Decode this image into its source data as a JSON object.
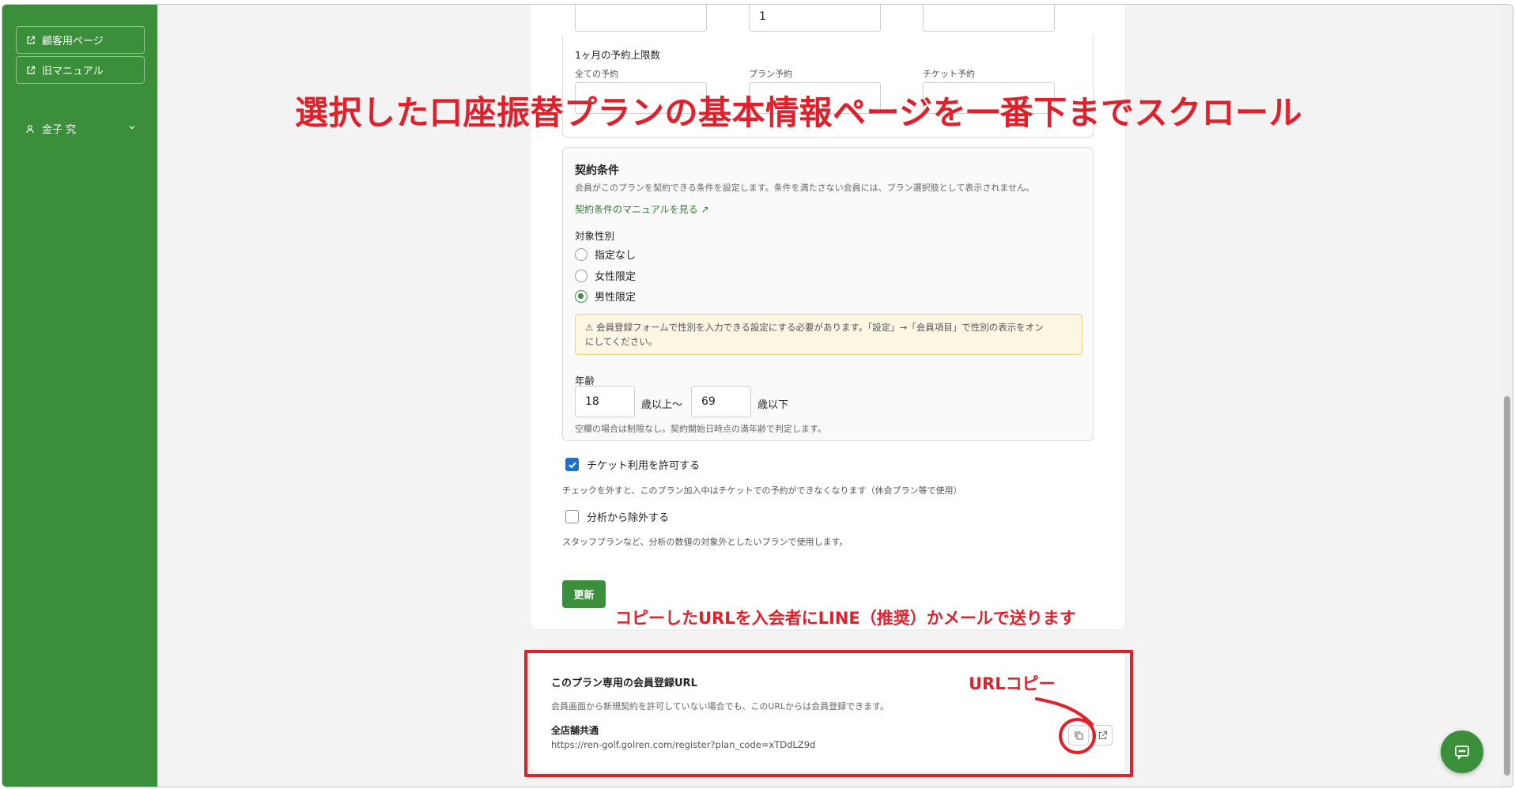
{
  "sidebar": {
    "customer_page": "顧客用ページ",
    "old_manual": "旧マニュアル",
    "user_name": "金子 究"
  },
  "limits": {
    "top_values": [
      "",
      "1",
      ""
    ],
    "monthly_title": "1ヶ月の予約上限数",
    "all_label": "全ての予約",
    "plan_label": "プラン予約",
    "ticket_label": "チケット予約"
  },
  "contract": {
    "title": "契約条件",
    "description": "会員がこのプランを契約できる条件を設定します。条件を満たさない会員には、プラン選択肢として表示されません。",
    "manual_link": "契約条件のマニュアルを見る ↗",
    "gender_label": "対象性別",
    "gender_options": [
      "指定なし",
      "女性限定",
      "男性限定"
    ],
    "gender_selected": 2,
    "warning_line1": "⚠ 会員登録フォームで性別を入力できる設定にする必要があります。「設定」→「会員項目」で性別の表示をオン",
    "warning_line2": "にしてください。",
    "age_label": "年齢",
    "age_min": "18",
    "age_min_suffix": "歳以上〜",
    "age_max": "69",
    "age_max_suffix": "歳以下",
    "age_note": "空欄の場合は制限なし。契約開始日時点の満年齢で判定します。"
  },
  "ticket": {
    "label": "チケット利用を許可する",
    "checked": true,
    "note": "チェックを外すと、このプラン加入中はチケットでの予約ができなくなります（休会プラン等で使用）"
  },
  "analysis": {
    "label": "分析から除外する",
    "checked": false,
    "note": "スタッフプランなど、分析の数値の対象外としたいプランで使用します。"
  },
  "update_button": "更新",
  "url_section": {
    "title": "このプラン専用の会員登録URL",
    "description": "会員画面から新規契約を許可していない場合でも、このURLからは会員登録できます。",
    "store_label": "全店舗共通",
    "url": "https://ren-golf.golren.com/register?plan_code=xTDdLZ9d"
  },
  "annotations": {
    "top": "選択した口座振替プランの基本情報ページを一番下までスクロール",
    "middle": "コピーしたURLを入会者にLINE（推奨）かメールで送ります",
    "copy": "URLコピー"
  },
  "colors": {
    "sidebar": "#3b8f3a",
    "annotation": "#e0202a",
    "checkbox": "#1f6fd1"
  }
}
